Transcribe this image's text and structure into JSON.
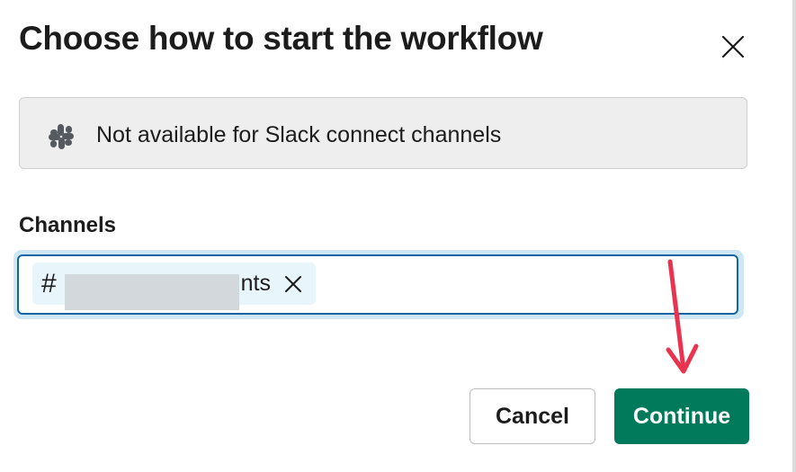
{
  "dialog": {
    "title": "Choose how to start the workflow"
  },
  "notice": {
    "text": "Not available for Slack connect channels",
    "icon": "slack-logo-icon"
  },
  "channels_field": {
    "label": "Channels",
    "chips": [
      {
        "prefix": "#",
        "name_visible": "nts"
      }
    ]
  },
  "actions": {
    "cancel_label": "Cancel",
    "continue_label": "Continue"
  },
  "colors": {
    "primary": "#007a5a",
    "focus": "#1264a3",
    "annotation": "#e8344e"
  }
}
